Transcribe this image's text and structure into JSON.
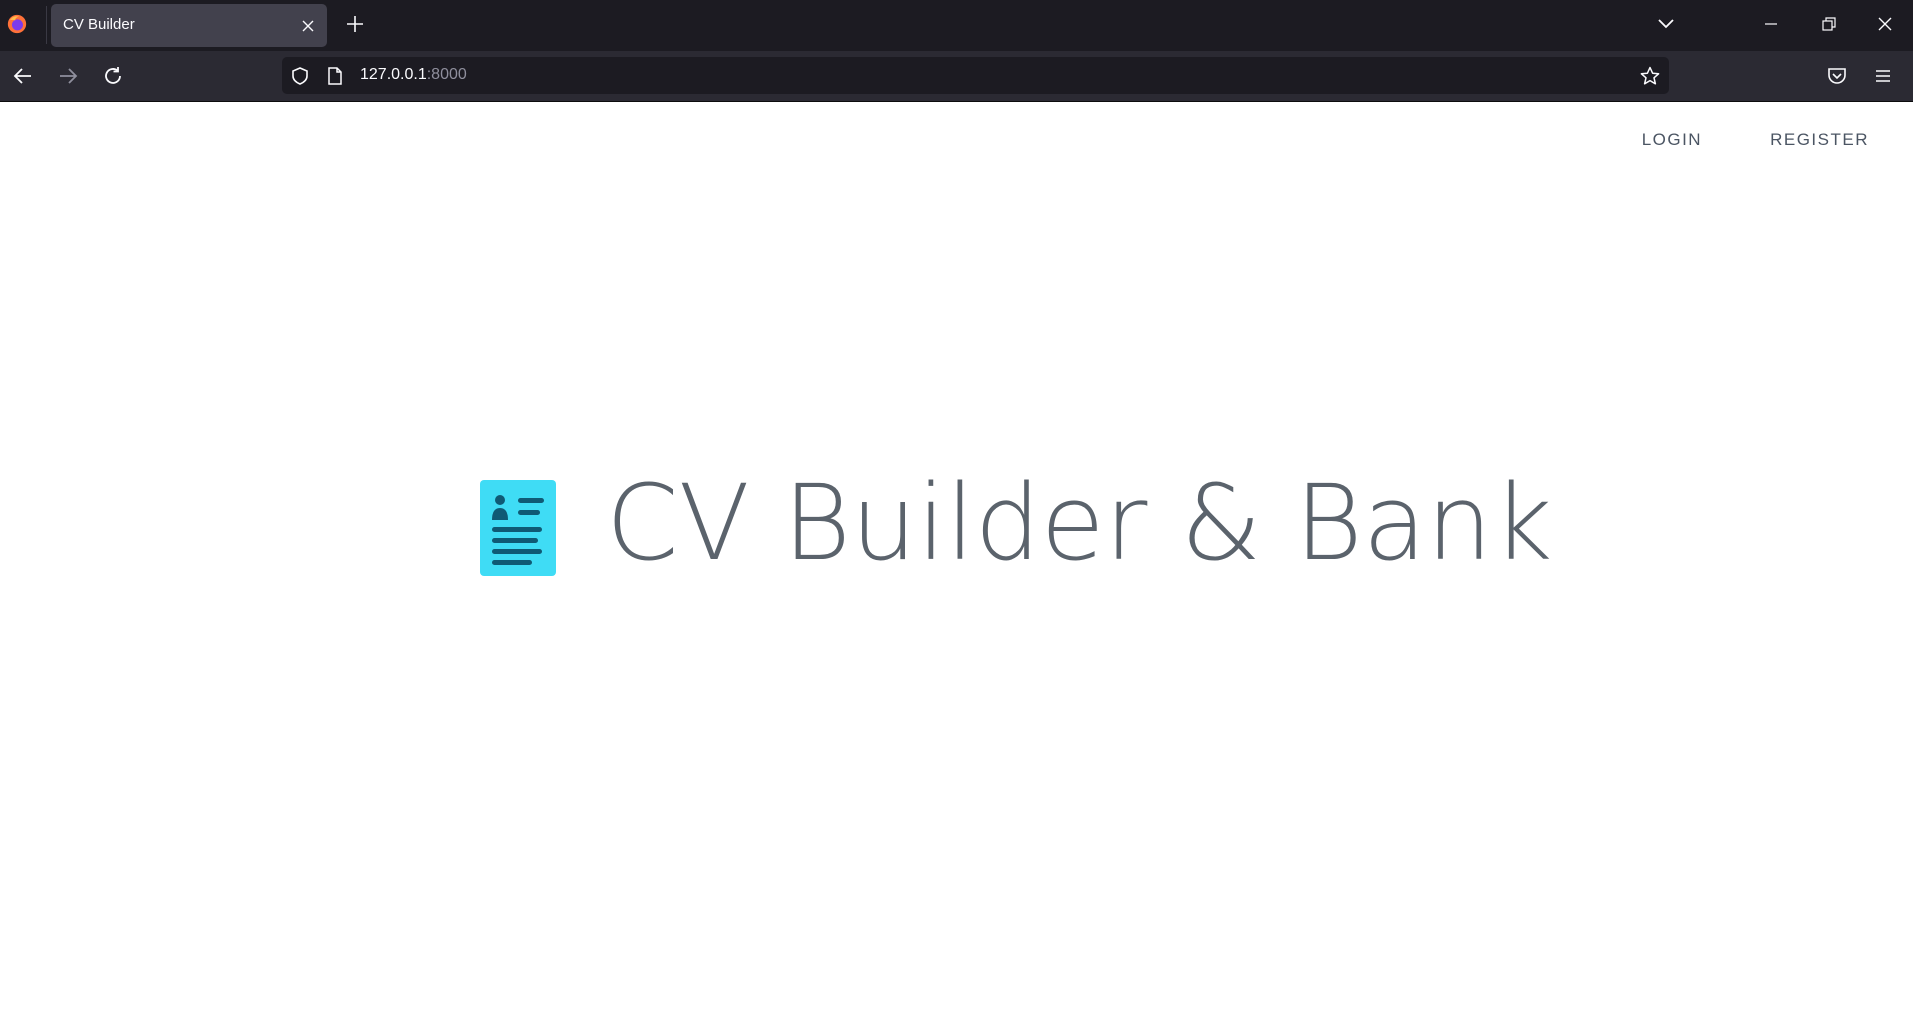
{
  "browser": {
    "tab_title": "CV Builder",
    "url_host": "127.0.0.1",
    "url_port": ":8000"
  },
  "nav": {
    "login": "LOGIN",
    "register": "REGISTER"
  },
  "hero": {
    "title": "CV Builder & Bank",
    "logo_icon": "cv-document-icon"
  },
  "colors": {
    "logo": "#3fdcf5",
    "logo_lines": "#0f5a75",
    "title": "#5b636c",
    "chrome_dark": "#1c1b22",
    "chrome_toolbar": "#2b2a33"
  }
}
